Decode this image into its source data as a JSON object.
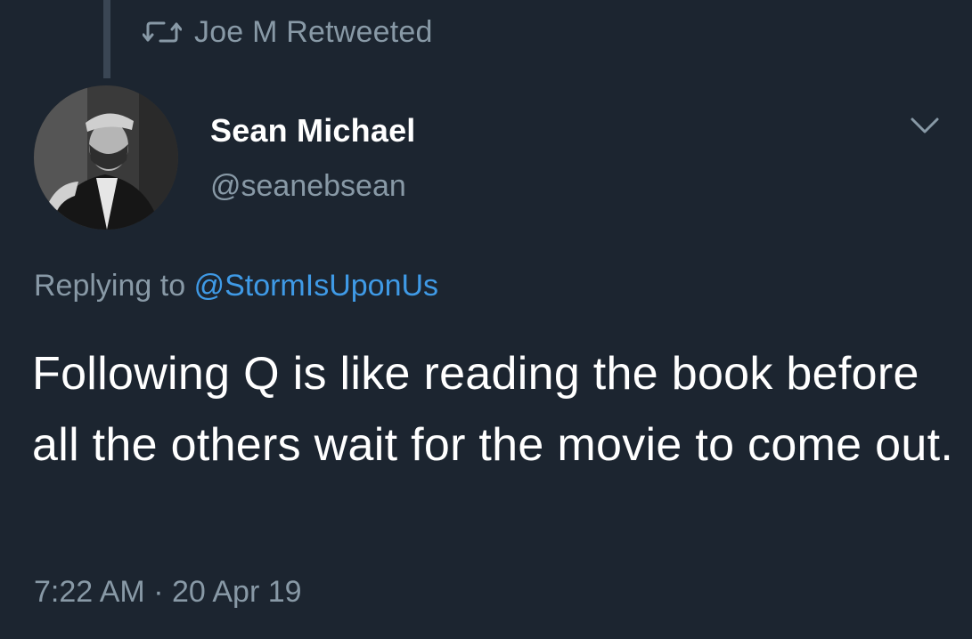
{
  "retweet": {
    "icon": "retweet-icon",
    "text": "Joe M Retweeted"
  },
  "author": {
    "name": "Sean Michael",
    "handle": "@seanebsean",
    "avatar_icon": "avatar-photo"
  },
  "menu": {
    "icon": "chevron-down-icon"
  },
  "reply": {
    "prefix": "Replying to",
    "target": "@StormIsUponUs"
  },
  "tweet": {
    "text": "Following Q is like reading the book before all the others wait for the movie to come out."
  },
  "timestamp": {
    "time": "7:22 AM",
    "separator": "·",
    "date": "20 Apr 19"
  },
  "colors": {
    "background": "#1c2530",
    "secondary_text": "#8899a6",
    "link": "#3f9ae6",
    "primary_text": "#ffffff"
  }
}
